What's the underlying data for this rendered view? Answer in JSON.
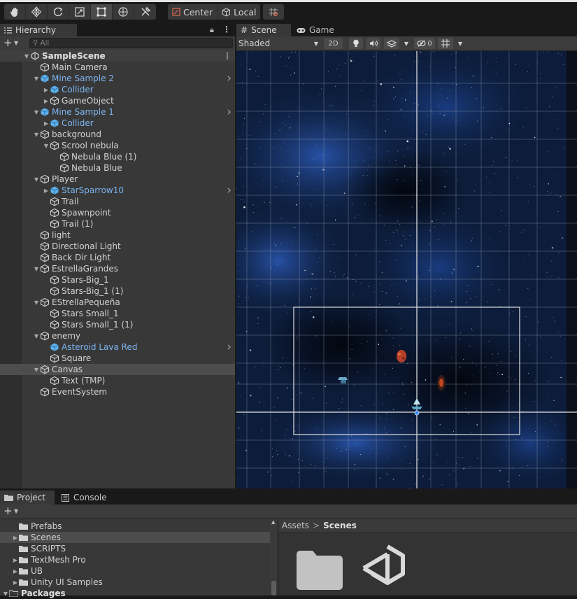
{
  "toolbar": {
    "tools": [
      "hand-tool",
      "move-tool",
      "rotate-tool",
      "scale-tool",
      "rect-tool",
      "transform-tool",
      "custom-editor-tool"
    ],
    "active_tool": "rect-tool",
    "pivot_label": "Center",
    "space_label": "Local"
  },
  "hierarchy": {
    "tab_label": "Hierarchy",
    "search_placeholder": "All",
    "scene_name": "SampleScene",
    "items": [
      {
        "label": "Main Camera",
        "depth": 1,
        "caret": "",
        "prefab": false
      },
      {
        "label": "Mine Sample 2",
        "depth": 1,
        "caret": "open",
        "prefab": true,
        "chevron": true
      },
      {
        "label": "Collider",
        "depth": 2,
        "caret": "closed",
        "prefab": true
      },
      {
        "label": "GameObject",
        "depth": 2,
        "caret": "closed",
        "prefab": false
      },
      {
        "label": "Mine Sample 1",
        "depth": 1,
        "caret": "open",
        "prefab": true,
        "chevron": true
      },
      {
        "label": "Collider",
        "depth": 2,
        "caret": "closed",
        "prefab": true
      },
      {
        "label": "background",
        "depth": 1,
        "caret": "open",
        "prefab": false
      },
      {
        "label": "Scrool nebula",
        "depth": 2,
        "caret": "open",
        "prefab": false
      },
      {
        "label": "Nebula Blue (1)",
        "depth": 3,
        "caret": "",
        "prefab": false
      },
      {
        "label": "Nebula Blue",
        "depth": 3,
        "caret": "",
        "prefab": false
      },
      {
        "label": "Player",
        "depth": 1,
        "caret": "open",
        "prefab": false
      },
      {
        "label": "StarSparrow10",
        "depth": 2,
        "caret": "closed",
        "prefab": true,
        "chevron": true
      },
      {
        "label": "Trail",
        "depth": 2,
        "caret": "",
        "prefab": false
      },
      {
        "label": "Spawnpoint",
        "depth": 2,
        "caret": "",
        "prefab": false
      },
      {
        "label": "Trail (1)",
        "depth": 2,
        "caret": "",
        "prefab": false
      },
      {
        "label": "light",
        "depth": 1,
        "caret": "",
        "prefab": false
      },
      {
        "label": "Directional Light",
        "depth": 1,
        "caret": "",
        "prefab": false
      },
      {
        "label": "Back Dir Light",
        "depth": 1,
        "caret": "",
        "prefab": false
      },
      {
        "label": "EstrellaGrandes",
        "depth": 1,
        "caret": "open",
        "prefab": false
      },
      {
        "label": "Stars-Big_1",
        "depth": 2,
        "caret": "",
        "prefab": false
      },
      {
        "label": "Stars-Big_1 (1)",
        "depth": 2,
        "caret": "",
        "prefab": false
      },
      {
        "label": "EStrellaPequeña",
        "depth": 1,
        "caret": "open",
        "prefab": false
      },
      {
        "label": "Stars Small_1",
        "depth": 2,
        "caret": "",
        "prefab": false
      },
      {
        "label": "Stars Small_1 (1)",
        "depth": 2,
        "caret": "",
        "prefab": false
      },
      {
        "label": "enemy",
        "depth": 1,
        "caret": "open",
        "prefab": false
      },
      {
        "label": "Asteroid Lava Red",
        "depth": 2,
        "caret": "",
        "prefab": true,
        "chevron": true
      },
      {
        "label": "Square",
        "depth": 2,
        "caret": "",
        "prefab": false
      },
      {
        "label": "Canvas",
        "depth": 1,
        "caret": "open",
        "prefab": false,
        "selected": true
      },
      {
        "label": "Text (TMP)",
        "depth": 2,
        "caret": "",
        "prefab": false
      },
      {
        "label": "EventSystem",
        "depth": 1,
        "caret": "",
        "prefab": false
      }
    ]
  },
  "scene": {
    "tab_scene": "Scene",
    "tab_game": "Game",
    "draw_mode": "Shaded",
    "mode_2d": "2D",
    "hidden_count": "0"
  },
  "project": {
    "tab_project": "Project",
    "tab_console": "Console",
    "tree": [
      {
        "label": "Prefabs",
        "caret": "",
        "selected": false
      },
      {
        "label": "Scenes",
        "caret": "closed",
        "selected": true
      },
      {
        "label": "SCRIPTS",
        "caret": "",
        "selected": false
      },
      {
        "label": "TextMesh Pro",
        "caret": "closed",
        "selected": false
      },
      {
        "label": "UB",
        "caret": "closed",
        "selected": false
      },
      {
        "label": "Unity UI Samples",
        "caret": "closed",
        "selected": false
      },
      {
        "label": "Packages",
        "caret": "open",
        "selected": false,
        "root": true
      }
    ],
    "breadcrumb_root": "Assets",
    "breadcrumb_sep": ">",
    "breadcrumb_current": "Scenes"
  },
  "colors": {
    "panel": "#383838",
    "prefab_text": "#7cb3ef",
    "selection": "#4d4d4d",
    "viewport_bg": "#0b1a33"
  }
}
